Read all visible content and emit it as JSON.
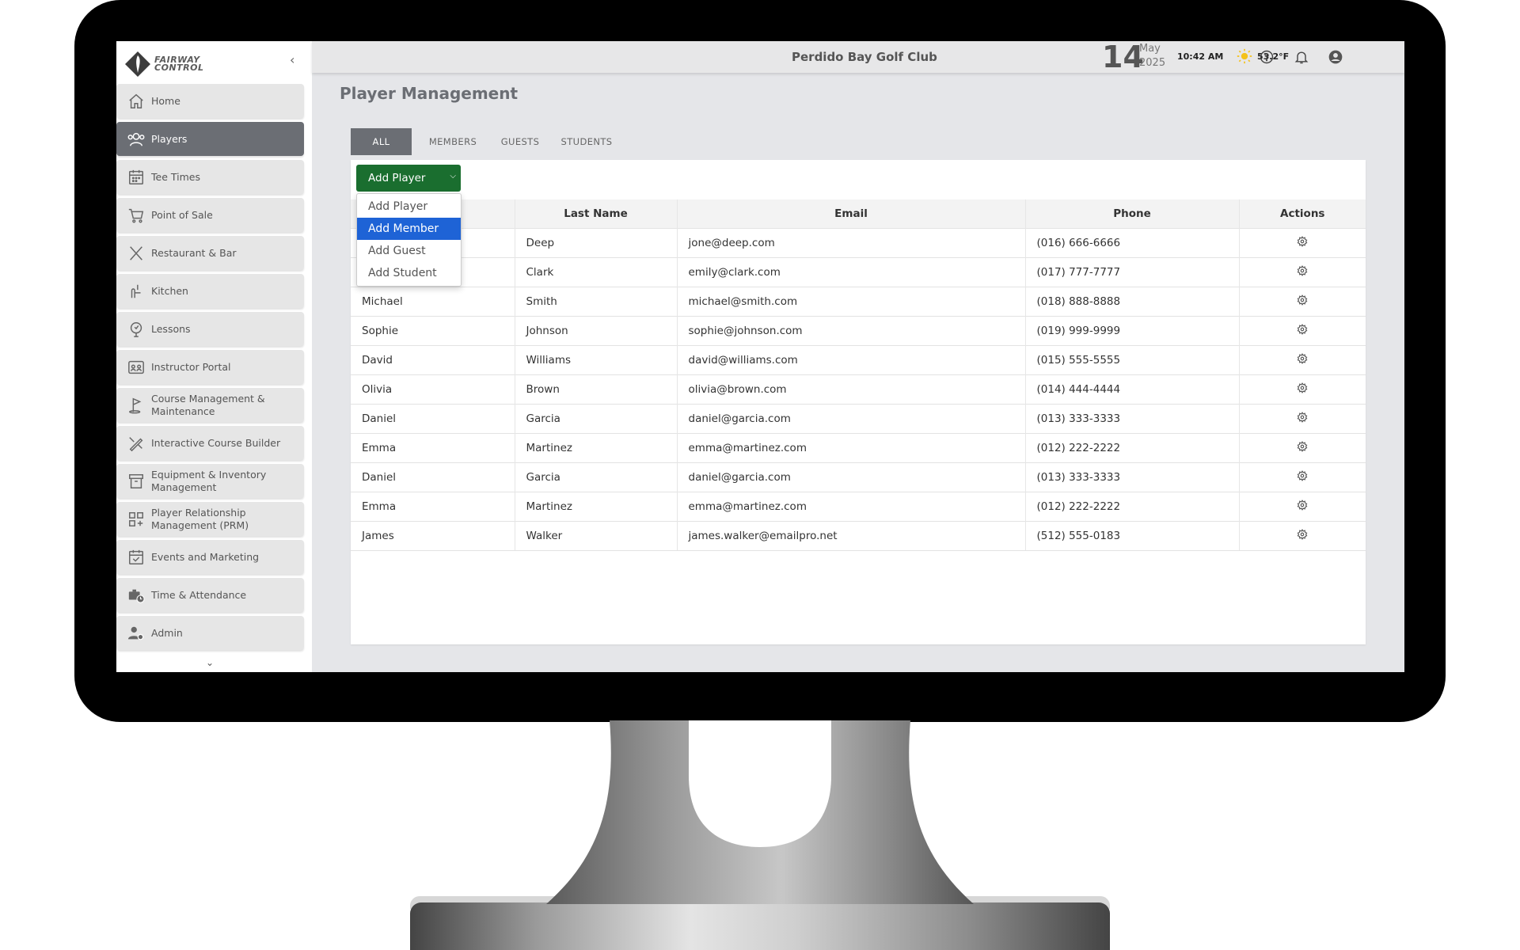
{
  "app": {
    "club_name": "Perdido Bay Golf Club",
    "logo_line1": "FAIRWAY",
    "logo_line2": "CONTROL"
  },
  "header": {
    "day": "14",
    "month": "May",
    "year": "2025",
    "time": "10:42  AM",
    "temperature": "53.2°F",
    "icons": [
      "help-icon",
      "bell-icon",
      "user-account-icon"
    ]
  },
  "sidebar": {
    "items": [
      {
        "label": "Home",
        "icon": "home-icon"
      },
      {
        "label": "Players",
        "icon": "players-icon",
        "active": true
      },
      {
        "label": "Tee Times",
        "icon": "calendar-icon"
      },
      {
        "label": "Point of Sale",
        "icon": "cart-icon"
      },
      {
        "label": "Restaurant & Bar",
        "icon": "utensils-icon"
      },
      {
        "label": "Kitchen",
        "icon": "kitchen-icon"
      },
      {
        "label": "Lessons",
        "icon": "lessons-icon"
      },
      {
        "label": "Instructor Portal",
        "icon": "instructor-icon"
      },
      {
        "label": "Course Management & Maintenance",
        "icon": "flag-icon"
      },
      {
        "label": "Interactive Course Builder",
        "icon": "course-builder-icon"
      },
      {
        "label": "Equipment & Inventory Management",
        "icon": "inventory-icon"
      },
      {
        "label": "Player Relationship Management (PRM)",
        "icon": "prm-icon"
      },
      {
        "label": "Events and Marketing",
        "icon": "events-icon"
      },
      {
        "label": "Time & Attendance",
        "icon": "time-attendance-icon"
      },
      {
        "label": "Admin",
        "icon": "admin-icon"
      }
    ]
  },
  "main": {
    "title": "Player Management",
    "tabs": [
      "ALL",
      "MEMBERS",
      "GUESTS",
      "STUDENTS"
    ],
    "active_tab": "ALL",
    "add_button_label": "Add Player",
    "dropdown": {
      "items": [
        "Add Player",
        "Add Member",
        "Add Guest",
        "Add Student"
      ],
      "selected": "Add Member"
    },
    "table": {
      "columns": [
        "",
        "Last Name",
        "Email",
        "Phone",
        "Actions"
      ],
      "rows": [
        {
          "first": "",
          "last": "Deep",
          "email": "jone@deep.com",
          "phone": "(016) 666-6666"
        },
        {
          "first": "",
          "last": "Clark",
          "email": "emily@clark.com",
          "phone": "(017) 777-7777"
        },
        {
          "first": "Michael",
          "last": "Smith",
          "email": "michael@smith.com",
          "phone": "(018) 888-8888"
        },
        {
          "first": "Sophie",
          "last": "Johnson",
          "email": "sophie@johnson.com",
          "phone": "(019) 999-9999"
        },
        {
          "first": "David",
          "last": "Williams",
          "email": "david@williams.com",
          "phone": "(015) 555-5555"
        },
        {
          "first": "Olivia",
          "last": "Brown",
          "email": "olivia@brown.com",
          "phone": "(014) 444-4444"
        },
        {
          "first": "Daniel",
          "last": "Garcia",
          "email": "daniel@garcia.com",
          "phone": "(013) 333-3333"
        },
        {
          "first": "Emma",
          "last": "Martinez",
          "email": "emma@martinez.com",
          "phone": "(012) 222-2222"
        },
        {
          "first": "Daniel",
          "last": "Garcia",
          "email": "daniel@garcia.com",
          "phone": "(013) 333-3333"
        },
        {
          "first": "Emma",
          "last": "Martinez",
          "email": "emma@martinez.com",
          "phone": "(012) 222-2222"
        },
        {
          "first": "James",
          "last": "Walker",
          "email": "james.walker@emailpro.net",
          "phone": "(512) 555-0183"
        }
      ]
    }
  },
  "colors": {
    "accent_green": "#1a6e2f",
    "active_gray": "#6b6e74",
    "dropdown_highlight": "#1e63d6"
  }
}
